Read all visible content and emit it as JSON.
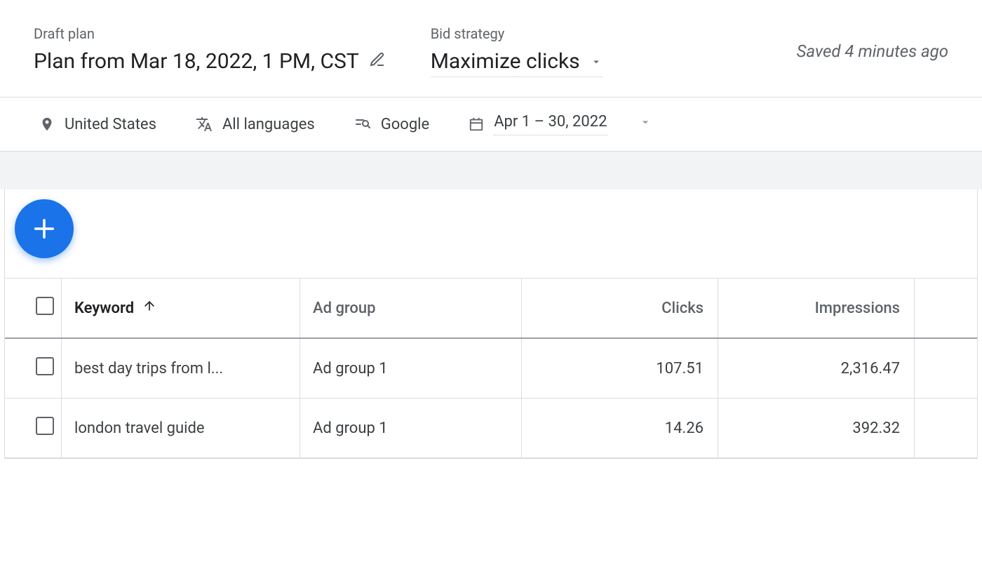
{
  "header": {
    "plan_label": "Draft plan",
    "plan_name": "Plan from Mar 18, 2022, 1 PM, CST",
    "bid_label": "Bid strategy",
    "bid_value": "Maximize clicks",
    "saved_text": "Saved 4 minutes ago"
  },
  "filters": {
    "location": "United States",
    "languages": "All languages",
    "networks": "Google",
    "date_range": "Apr 1 – 30, 2022"
  },
  "table": {
    "headers": {
      "keyword": "Keyword",
      "ad_group": "Ad group",
      "clicks": "Clicks",
      "impressions": "Impressions"
    },
    "rows": [
      {
        "keyword": "best day trips from l...",
        "ad_group": "Ad group 1",
        "clicks": "107.51",
        "impressions": "2,316.47"
      },
      {
        "keyword": "london travel guide",
        "ad_group": "Ad group 1",
        "clicks": "14.26",
        "impressions": "392.32"
      }
    ]
  }
}
